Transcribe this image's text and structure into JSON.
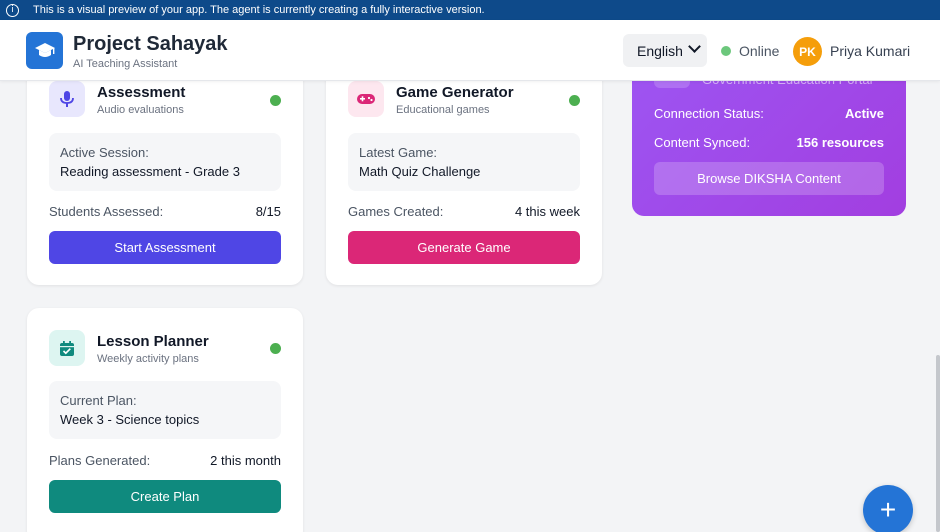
{
  "banner": {
    "text": "This is a visual preview of your app. The agent is currently creating a fully interactive version."
  },
  "header": {
    "title": "Project Sahayak",
    "subtitle": "AI Teaching Assistant",
    "language": "English",
    "status": "Online",
    "user_initials": "PK",
    "user_name": "Priya Kumari"
  },
  "cards": {
    "assessment": {
      "title": "Assessment",
      "subtitle": "Audio evaluations",
      "info_label": "Active Session:",
      "info_value": "Reading assessment - Grade 3",
      "stat_label": "Students Assessed:",
      "stat_value": "8/15",
      "button": "Start Assessment"
    },
    "game": {
      "title": "Game Generator",
      "subtitle": "Educational games",
      "info_label": "Latest Game:",
      "info_value": "Math Quiz Challenge",
      "stat_label": "Games Created:",
      "stat_value": "4 this week",
      "button": "Generate Game"
    },
    "lesson": {
      "title": "Lesson Planner",
      "subtitle": "Weekly activity plans",
      "info_label": "Current Plan:",
      "info_value": "Week 3 - Science topics",
      "stat_label": "Plans Generated:",
      "stat_value": "2 this month",
      "button": "Create Plan"
    }
  },
  "diksha": {
    "portal_text": "Government Education Portal",
    "connection_label": "Connection Status:",
    "connection_value": "Active",
    "synced_label": "Content Synced:",
    "synced_value": "156 resources",
    "button": "Browse DIKSHA Content"
  },
  "fab_label": "+",
  "colors": {
    "brand": "#2474d6",
    "assessment": "#4f46e5",
    "game": "#db2777",
    "lesson": "#0f8a7e",
    "online": "#6cc77c",
    "diksha": "#9d55f2"
  }
}
